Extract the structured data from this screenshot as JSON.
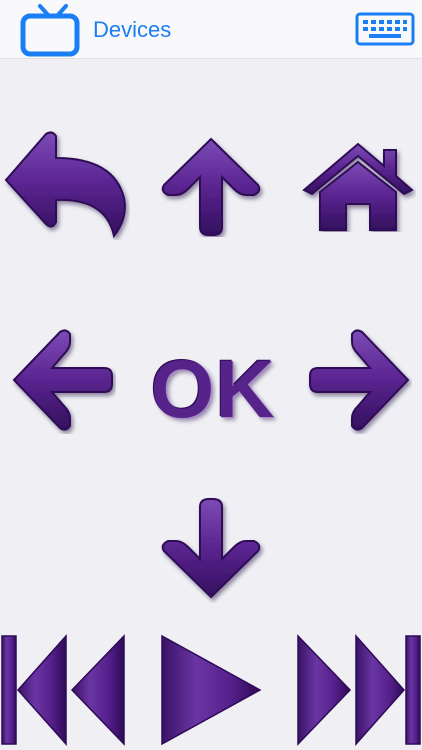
{
  "header": {
    "devices_label": "Devices",
    "tv_icon": "tv-icon",
    "keyboard_icon": "keyboard-icon"
  },
  "remote": {
    "ok_label": "OK",
    "buttons": [
      "back-icon",
      "up-arrow-icon",
      "home-icon",
      "left-arrow-icon",
      "right-arrow-icon",
      "down-arrow-icon",
      "rewind-icon",
      "play-icon",
      "fast-forward-icon"
    ]
  },
  "colors": {
    "accent_blue": "#1a7ef5",
    "button_purple": "#5a2490",
    "button_purple_dark": "#2f0b57",
    "background": "#efeff4"
  }
}
